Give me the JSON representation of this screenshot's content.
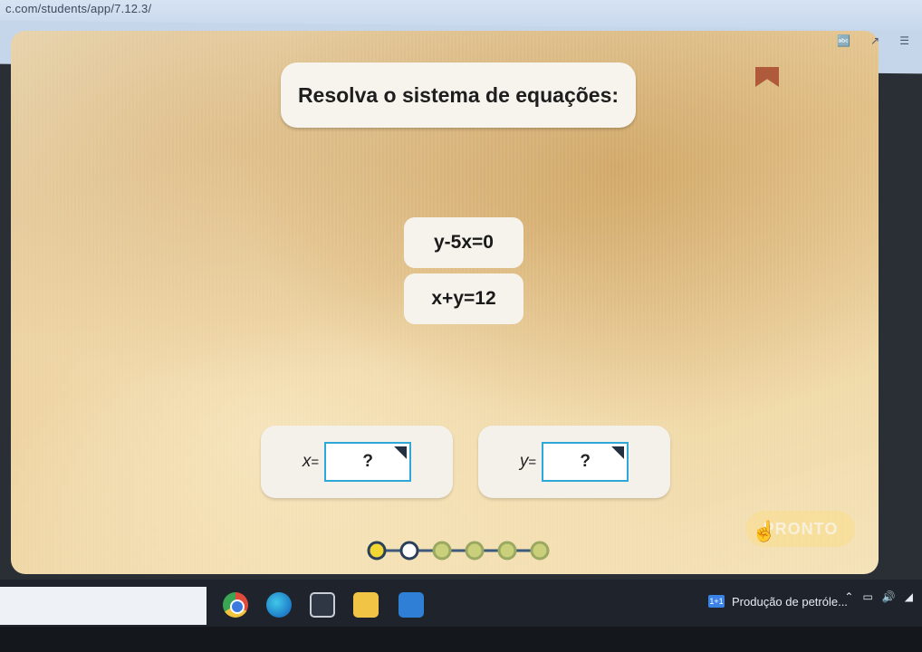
{
  "browser": {
    "url": "c.com/students/app/7.12.3/",
    "icons": [
      "translate-icon",
      "share-icon",
      "extensions-icon"
    ]
  },
  "problem": {
    "title": "Resolva o sistema de equações:",
    "equations": [
      "y-5x=0",
      "x+y=12"
    ]
  },
  "answers": {
    "x": {
      "label": "x",
      "equals": "=",
      "value": "?"
    },
    "y": {
      "label": "y",
      "equals": "=",
      "value": "?"
    }
  },
  "submit_label": "PRONTO",
  "progress": {
    "total_steps": 6,
    "current_step": 1
  },
  "taskbar": {
    "apps": [
      "chrome-icon",
      "edge-icon",
      "store-icon",
      "file-explorer-icon",
      "mail-icon"
    ],
    "notification_text": "Produção de petróle...",
    "notification_badge": "1+1"
  },
  "colors": {
    "input_border": "#2da8d8",
    "progress_current": "#f2d633",
    "progress_todo": "#c9cf7a",
    "bookmark": "#b05a3c"
  }
}
